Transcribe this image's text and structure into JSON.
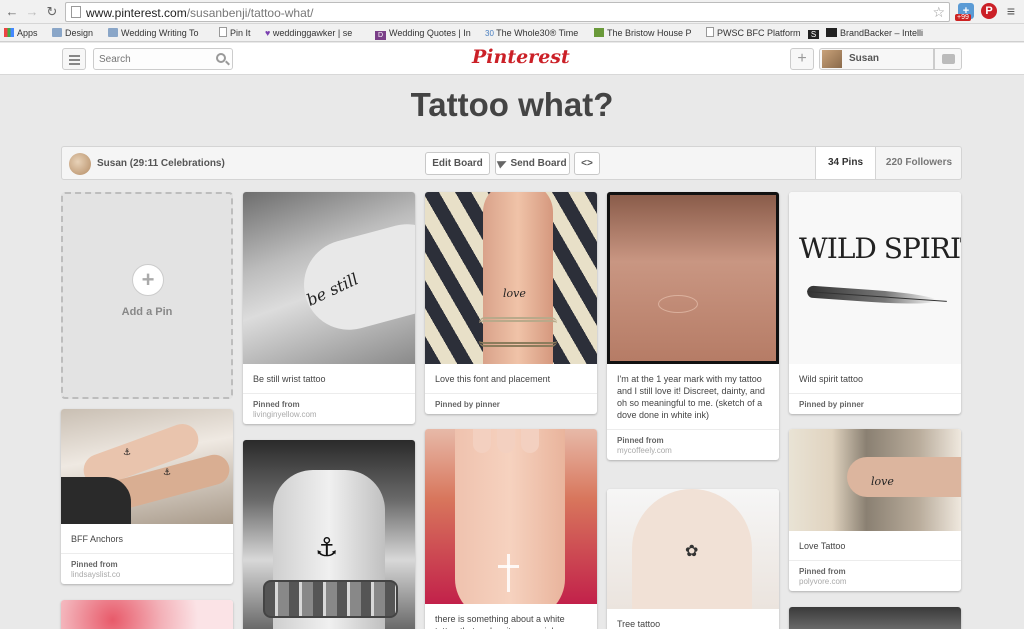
{
  "browser": {
    "url_host": "www.pinterest.com",
    "url_path": "/susanbenji/tattoo-what/",
    "bookmarks": [
      {
        "label": "Apps",
        "icon": "apps-grid-icon"
      },
      {
        "label": "Design",
        "icon": "folder-icon"
      },
      {
        "label": "Wedding Writing To",
        "icon": "folder-icon"
      },
      {
        "label": "Pin It",
        "icon": "page-icon"
      },
      {
        "label": "weddinggawker | se",
        "icon": "heart-icon"
      },
      {
        "label": "Wedding Quotes | In",
        "icon": "d-logo-icon"
      },
      {
        "label": "The Whole30® Time",
        "icon": "whole30-icon"
      },
      {
        "label": "The Bristow House P",
        "icon": "house-icon"
      },
      {
        "label": "PWSC BFC Platform",
        "icon": "page-icon"
      },
      {
        "label": "S",
        "icon": "s-logo-icon"
      },
      {
        "label": "BrandBacker – Intelli",
        "icon": "brandbacker-icon"
      }
    ],
    "ext_badge": "+99"
  },
  "header": {
    "search_placeholder": "Search",
    "logo_text": "Pinterest",
    "user_name": "Susan"
  },
  "board": {
    "title": "Tattoo what?",
    "owner": "Susan (29:11 Celebrations)",
    "edit_label": "Edit Board",
    "send_label": "Send Board",
    "embed_label": "<>",
    "pins_count": "34 Pins",
    "followers_count": "220 Followers"
  },
  "add_pin_label": "Add a Pin",
  "pins": [
    {
      "description": "Be still wrist tattoo",
      "source_label": "Pinned from",
      "source_site": "livinginyellow.com",
      "tattoo": "be still"
    },
    {
      "description": "Love this font and placement",
      "source_label": "Pinned by pinner",
      "source_site": "",
      "tattoo": "love"
    },
    {
      "description": "I'm at the 1 year mark with my tattoo and I still love it! Discreet, dainty, and oh so meaningful to me. (sketch of a dove done in white ink)",
      "source_label": "Pinned from",
      "source_site": "mycoffeely.com",
      "tattoo": ""
    },
    {
      "description": "Wild spirit tattoo",
      "source_label": "Pinned by pinner",
      "source_site": "",
      "tattoo": "WILD SPIRIT"
    },
    {
      "description": "BFF Anchors",
      "source_label": "Pinned from",
      "source_site": "lindsayslist.co",
      "tattoo": ""
    },
    {
      "description": "",
      "source_label": "",
      "source_site": "",
      "tattoo": ""
    },
    {
      "description": "there is something about a white tattoo that makes it so special",
      "source_label": "",
      "source_site": "",
      "tattoo": ""
    },
    {
      "description": "Tree tattoo",
      "source_label": "",
      "source_site": "",
      "tattoo": ""
    },
    {
      "description": "Love Tattoo",
      "source_label": "Pinned from",
      "source_site": "polyvore.com",
      "tattoo": "love"
    }
  ]
}
